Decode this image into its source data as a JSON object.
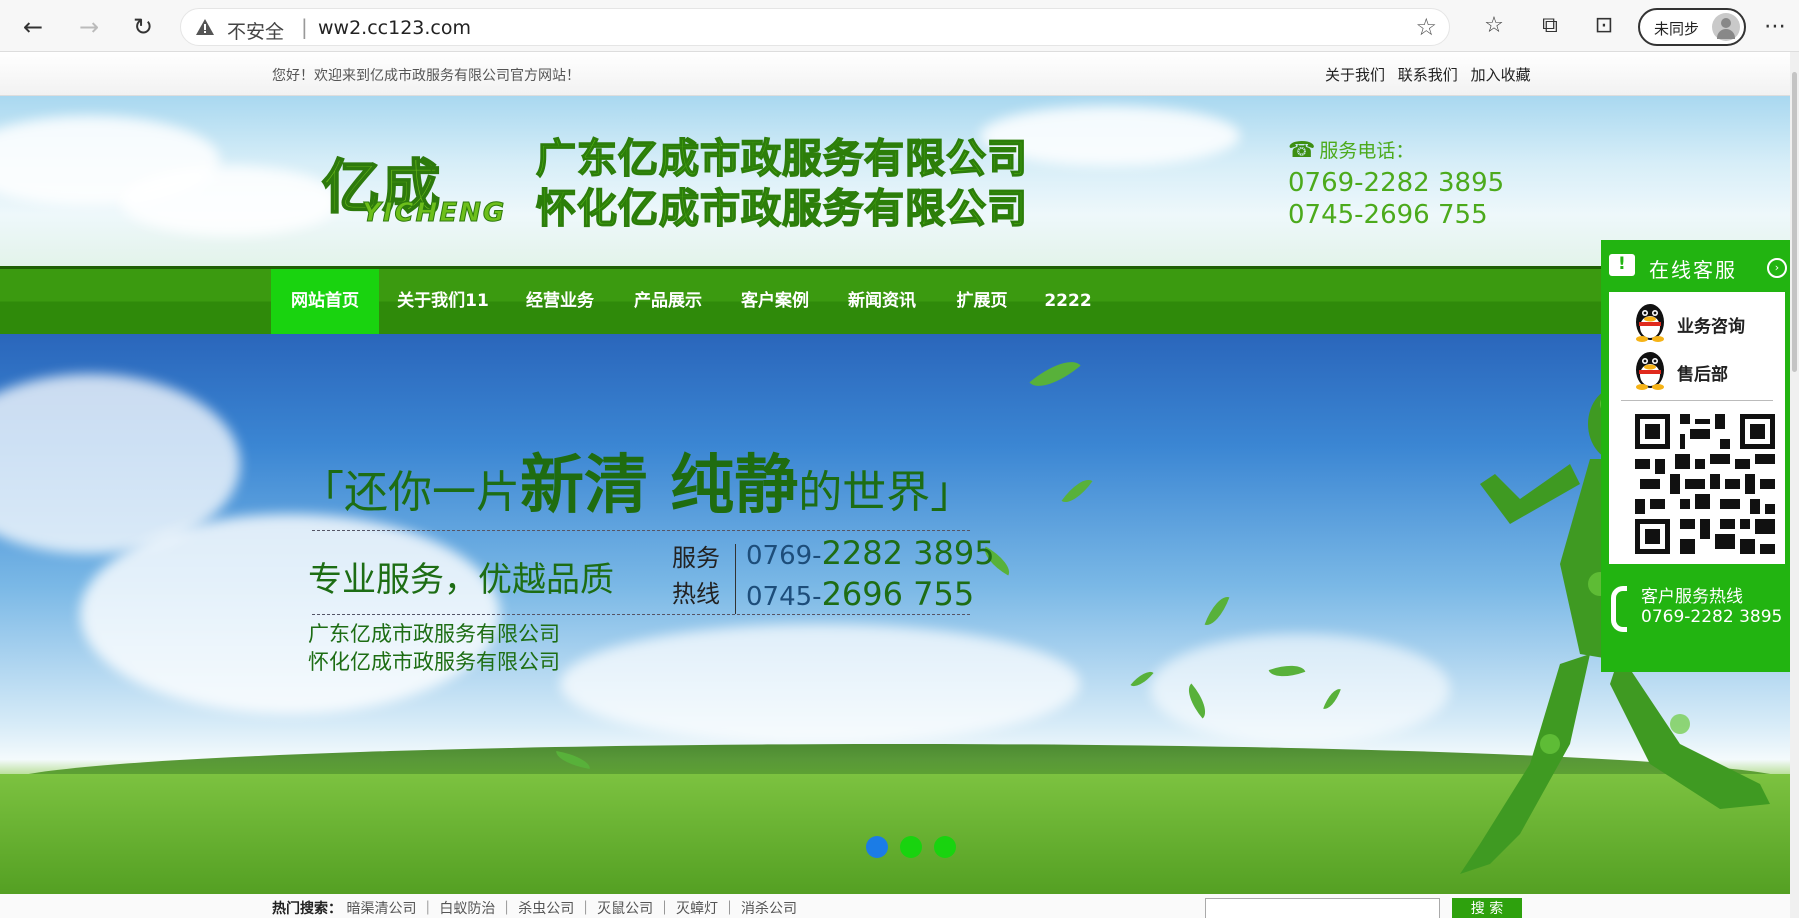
{
  "browser": {
    "insecure_label": "不安全",
    "url": "ww2.cc123.com",
    "sync_label": "未同步"
  },
  "topbar": {
    "welcome": "您好！欢迎来到亿成市政服务有限公司官方网站！",
    "links": [
      "关于我们",
      "联系我们",
      "加入收藏"
    ]
  },
  "header": {
    "logo_cn": "亿成",
    "logo_en": "YICHENG",
    "company_names": [
      "广东亿成市政服务有限公司",
      "怀化亿成市政服务有限公司"
    ],
    "phone_title": "服务电话：",
    "phones": [
      "0769-2282 3895",
      "0745-2696 755"
    ]
  },
  "nav": {
    "items": [
      "网站首页",
      "关于我们11",
      "经营业务",
      "产品展示",
      "客户案例",
      "新闻资讯",
      "扩展页",
      "2222"
    ],
    "active_index": 0
  },
  "banner": {
    "slogan_open": "「",
    "slogan_a": "还你一片",
    "slogan_b": "新清 纯静",
    "slogan_c": "的世界",
    "slogan_close": "」",
    "service_line": "专业服务，优越品质",
    "hotline_label_1": "服务",
    "hotline_label_2": "热线",
    "hotline_1_prefix": "0769-",
    "hotline_1_main": "2282 3895",
    "hotline_2_prefix": "0745-",
    "hotline_2_main": "2696 755",
    "companies": [
      "广东亿成市政服务有限公司",
      "怀化亿成市政服务有限公司"
    ],
    "slide_count": 3,
    "active_slide": 0
  },
  "online_service": {
    "title": "在线客服",
    "contacts": [
      "业务咨询",
      "售后部"
    ],
    "hotline_title": "客户服务热线",
    "hotline_number": "0769-2282 3895"
  },
  "bottom": {
    "hot_search_label": "热门搜索：",
    "hot_search_items": "暗渠清公司 ｜ 白蚁防治 ｜ 杀虫公司 ｜ 灭鼠公司 ｜ 灭蟑灯 ｜ 消杀公司",
    "search_button": "搜 索"
  },
  "colors": {
    "nav_green": "#3b9a10",
    "active_nav": "#19d30f",
    "panel_green": "#22b411",
    "slide_active": "#1b7ce6"
  }
}
